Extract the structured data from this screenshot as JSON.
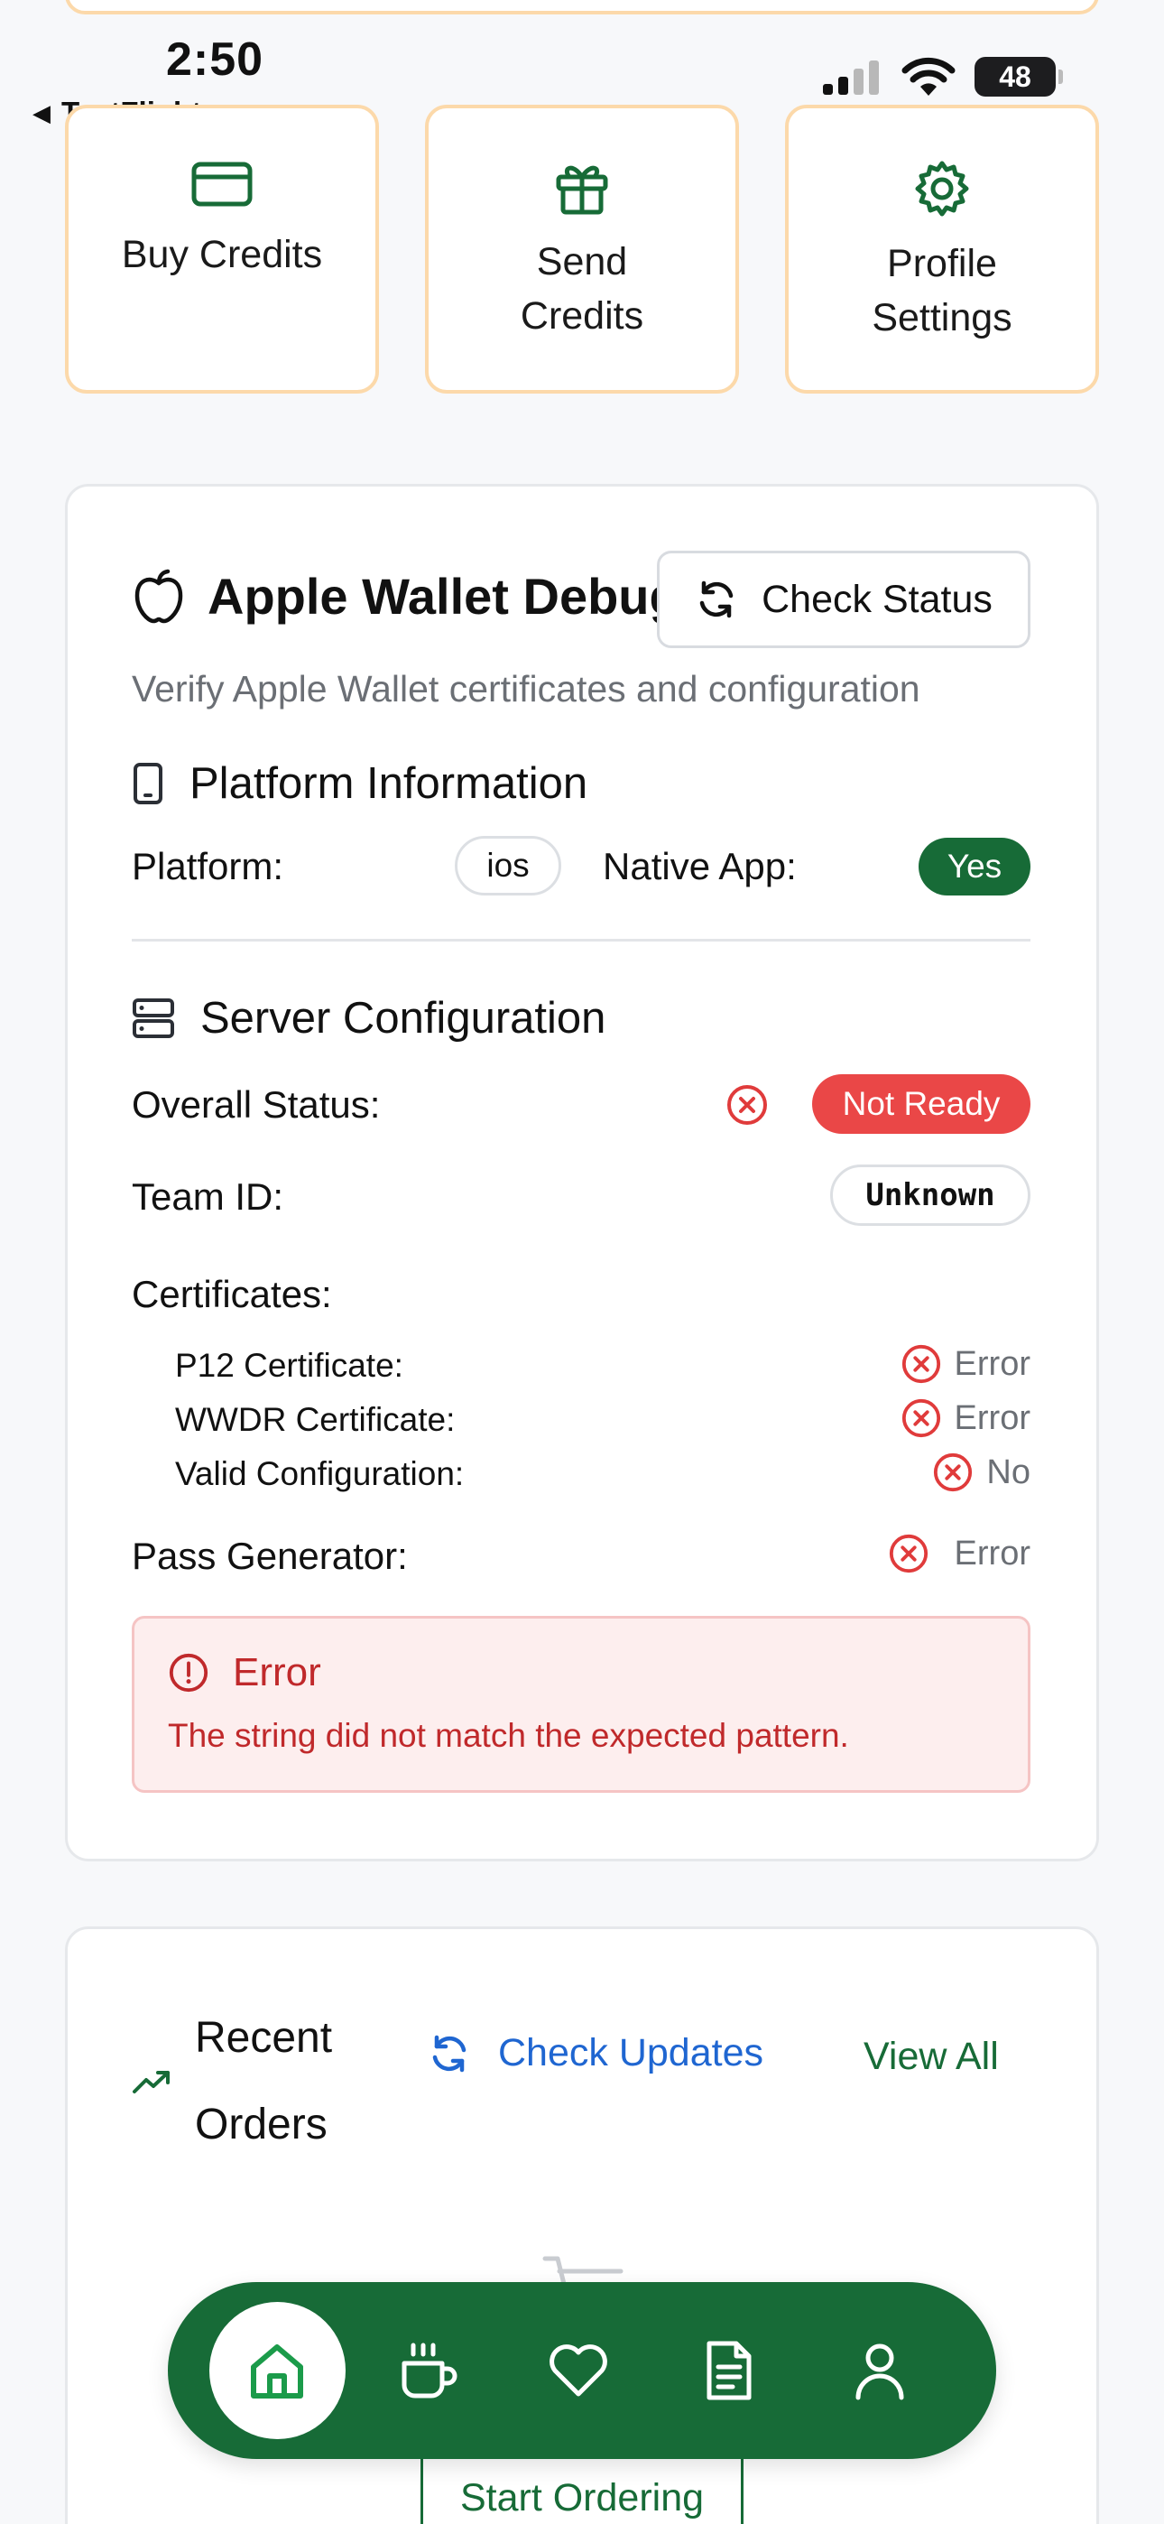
{
  "status_bar": {
    "time": "2:50",
    "back_app": "TestFlight",
    "battery": "48"
  },
  "actions": [
    {
      "label": "Buy Credits",
      "icon": "credit-card-icon"
    },
    {
      "label": "Send Credits",
      "icon": "gift-icon"
    },
    {
      "label": "Profile Settings",
      "icon": "gear-icon"
    }
  ],
  "wallet_debug": {
    "title": "Apple Wallet Debug",
    "check_status_label": "Check Status",
    "subtitle": "Verify Apple Wallet certificates and configuration",
    "platform_section": {
      "heading": "Platform Information",
      "platform_label": "Platform:",
      "platform_value": "ios",
      "native_label": "Native App:",
      "native_value": "Yes"
    },
    "server_section": {
      "heading": "Server Configuration",
      "overall_label": "Overall Status:",
      "overall_value": "Not Ready",
      "team_label": "Team ID:",
      "team_value": "Unknown",
      "certificates_label": "Certificates:",
      "certificates": [
        {
          "label": "P12 Certificate:",
          "value": "Error"
        },
        {
          "label": "WWDR Certificate:",
          "value": "Error"
        },
        {
          "label": "Valid Configuration:",
          "value": "No"
        }
      ],
      "pass_generator_label": "Pass Generator:",
      "pass_generator_value": "Error"
    },
    "error_box": {
      "title": "Error",
      "message": "The string did not match the expected pattern."
    }
  },
  "recent_orders": {
    "title": "Recent Orders",
    "check_updates_label": "Check Updates",
    "view_all_label": "View All",
    "start_ordering_label": "Start Ordering"
  },
  "bottom_nav": {
    "items": [
      "home-icon",
      "coffee-icon",
      "heart-icon",
      "document-icon",
      "user-icon"
    ],
    "active": "home-icon"
  },
  "colors": {
    "brand_green": "#176b37",
    "error_red": "#ea4747",
    "link_blue": "#1f66d1",
    "card_border_orange": "#fcd9aa"
  }
}
